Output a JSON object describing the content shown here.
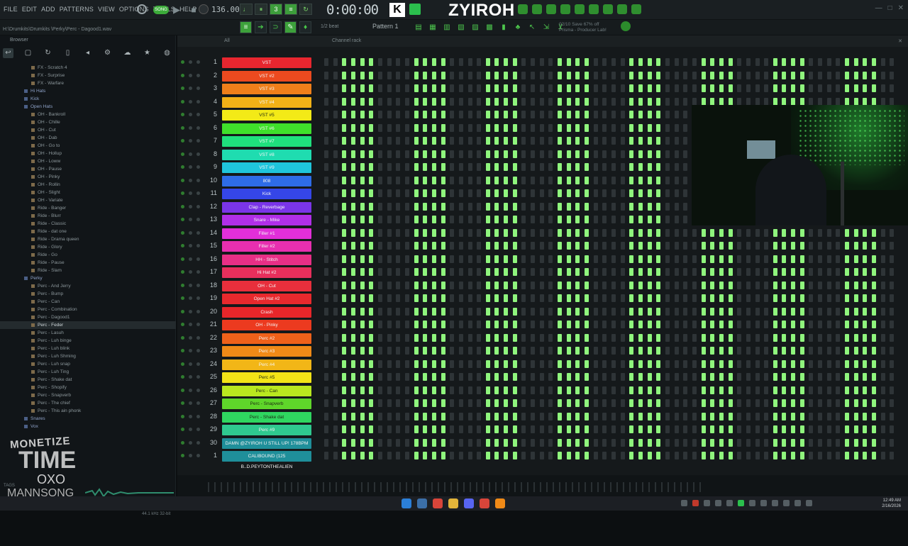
{
  "menu": [
    "FILE",
    "EDIT",
    "ADD",
    "PATTERNS",
    "VIEW",
    "OPTIONS",
    "TOOLS",
    "HELP"
  ],
  "tempo": "136.000",
  "song_button": "SONG",
  "time": "0:00:00",
  "streamer": "ZYIROH",
  "path": "H:\\Drumkits\\Drumkits \\Perky\\Perc - Dagood1.wav",
  "beat_snap": "1/2 beat",
  "pattern": "Pattern 1",
  "info_line1": "02/10  Save 67% off",
  "info_line2": "Prisma - Producer Lab!",
  "browser_title": "Browser",
  "channel_rack_title": "Channel rack",
  "channel_rack_filter": "All",
  "tree": [
    {
      "label": "FX - Scratch 4",
      "type": "file",
      "indent": 1
    },
    {
      "label": "FX - Surprise",
      "type": "file",
      "indent": 1
    },
    {
      "label": "FX - Warfare",
      "type": "file",
      "indent": 1
    },
    {
      "label": "Hi Hats",
      "type": "folder",
      "indent": 0
    },
    {
      "label": "Kick",
      "type": "folder",
      "indent": 0
    },
    {
      "label": "Open Hats",
      "type": "folder",
      "indent": 0
    },
    {
      "label": "OH - Bankroll",
      "type": "file",
      "indent": 1
    },
    {
      "label": "OH - Chille",
      "type": "file",
      "indent": 1
    },
    {
      "label": "OH - Cut",
      "type": "file",
      "indent": 1
    },
    {
      "label": "OH - Dab",
      "type": "file",
      "indent": 1
    },
    {
      "label": "OH - Go to",
      "type": "file",
      "indent": 1
    },
    {
      "label": "OH - Hollup",
      "type": "file",
      "indent": 1
    },
    {
      "label": "OH - Loww",
      "type": "file",
      "indent": 1
    },
    {
      "label": "OH - Pause",
      "type": "file",
      "indent": 1
    },
    {
      "label": "OH - Pinky",
      "type": "file",
      "indent": 1
    },
    {
      "label": "OH - Rollin",
      "type": "file",
      "indent": 1
    },
    {
      "label": "OH - Slight",
      "type": "file",
      "indent": 1
    },
    {
      "label": "OH - Variate",
      "type": "file",
      "indent": 1
    },
    {
      "label": "Ride - Banger",
      "type": "file",
      "indent": 1
    },
    {
      "label": "Ride - Blurr",
      "type": "file",
      "indent": 1
    },
    {
      "label": "Ride - Classic",
      "type": "file",
      "indent": 1
    },
    {
      "label": "Ride - dat one",
      "type": "file",
      "indent": 1
    },
    {
      "label": "Ride - Drama queen",
      "type": "file",
      "indent": 1
    },
    {
      "label": "Ride - Glory",
      "type": "file",
      "indent": 1
    },
    {
      "label": "Ride - Go",
      "type": "file",
      "indent": 1
    },
    {
      "label": "Ride - Pause",
      "type": "file",
      "indent": 1
    },
    {
      "label": "Ride - Slam",
      "type": "file",
      "indent": 1
    },
    {
      "label": "Perky",
      "type": "folder",
      "indent": 0
    },
    {
      "label": "Perc - And Jerry",
      "type": "file",
      "indent": 1
    },
    {
      "label": "Perc - Bump",
      "type": "file",
      "indent": 1
    },
    {
      "label": "Perc - Can",
      "type": "file",
      "indent": 1
    },
    {
      "label": "Perc - Combination",
      "type": "file",
      "indent": 1
    },
    {
      "label": "Perc - Dagood1",
      "type": "file",
      "indent": 1
    },
    {
      "label": "Perc - Feder",
      "type": "file",
      "indent": 1,
      "selected": true
    },
    {
      "label": "Perc - Lasuh",
      "type": "file",
      "indent": 1
    },
    {
      "label": "Perc - Luh binge",
      "type": "file",
      "indent": 1
    },
    {
      "label": "Perc - Luh blink",
      "type": "file",
      "indent": 1
    },
    {
      "label": "Perc - Luh Shming",
      "type": "file",
      "indent": 1
    },
    {
      "label": "Perc - Luh snap",
      "type": "file",
      "indent": 1
    },
    {
      "label": "Perc - Luh Ting",
      "type": "file",
      "indent": 1
    },
    {
      "label": "Perc - Shake dat",
      "type": "file",
      "indent": 1
    },
    {
      "label": "Perc - Shopify",
      "type": "file",
      "indent": 1
    },
    {
      "label": "Perc - Snapverb",
      "type": "file",
      "indent": 1
    },
    {
      "label": "Perc - The chief",
      "type": "file",
      "indent": 1
    },
    {
      "label": "Perc - This ain phonk",
      "type": "file",
      "indent": 1
    },
    {
      "label": "Snares",
      "type": "folder",
      "indent": 0
    },
    {
      "label": "Vox",
      "type": "folder",
      "indent": 0
    }
  ],
  "watermark": {
    "l1": "MONETIZE",
    "l2": "TIME",
    "l3": "OXO",
    "l4": "MANNSONG"
  },
  "sample_rate": "44.1 kHz 32-bit",
  "tags_label": "TAGS",
  "channels": [
    {
      "num": "1",
      "name": "VST",
      "color": "#e8262f"
    },
    {
      "num": "2",
      "name": "VST #2",
      "color": "#ec4a1f"
    },
    {
      "num": "3",
      "name": "VST #3",
      "color": "#ef7f1a"
    },
    {
      "num": "4",
      "name": "VST #4",
      "color": "#f2b117"
    },
    {
      "num": "5",
      "name": "VST #5",
      "color": "#f3ea17",
      "dark": true
    },
    {
      "num": "6",
      "name": "VST #6",
      "color": "#3fe02b"
    },
    {
      "num": "7",
      "name": "VST #7",
      "color": "#1fe07d"
    },
    {
      "num": "8",
      "name": "VST #8",
      "color": "#1fdcb0"
    },
    {
      "num": "9",
      "name": "VST #9",
      "color": "#1fc5dc"
    },
    {
      "num": "10",
      "name": "808",
      "color": "#2e6ce8"
    },
    {
      "num": "11",
      "name": "Kick",
      "color": "#3546e8"
    },
    {
      "num": "12",
      "name": "Clap - Reverbage",
      "color": "#7a35e8"
    },
    {
      "num": "13",
      "name": "Snare - Mike",
      "color": "#b12fe8"
    },
    {
      "num": "14",
      "name": "Filler #1",
      "color": "#e22fd9"
    },
    {
      "num": "15",
      "name": "Filler #2",
      "color": "#e82fb0"
    },
    {
      "num": "16",
      "name": "HH - Stitch",
      "color": "#e82f86"
    },
    {
      "num": "17",
      "name": "Hi Hat #2",
      "color": "#e82f5c"
    },
    {
      "num": "18",
      "name": "OH - Cut",
      "color": "#e82f3c"
    },
    {
      "num": "19",
      "name": "Open Hat #2",
      "color": "#e8292d"
    },
    {
      "num": "20",
      "name": "Crash",
      "color": "#e8262a"
    },
    {
      "num": "21",
      "name": "OH - Pinky",
      "color": "#ec3a1f"
    },
    {
      "num": "22",
      "name": "Perc #2",
      "color": "#ef611a"
    },
    {
      "num": "23",
      "name": "Perc #3",
      "color": "#f08a17"
    },
    {
      "num": "24",
      "name": "Perc #4",
      "color": "#f2b617"
    },
    {
      "num": "25",
      "name": "Perc #5",
      "color": "#f3e317",
      "dark": true
    },
    {
      "num": "26",
      "name": "Perc - Can",
      "color": "#b9e81f",
      "dark": true
    },
    {
      "num": "27",
      "name": "Perc - Snapverb",
      "color": "#5fd62a",
      "dark": true
    },
    {
      "num": "28",
      "name": "Perc - Shake dat",
      "color": "#2fd660",
      "dark": true
    },
    {
      "num": "29",
      "name": "Perc #9",
      "color": "#2fc98f"
    },
    {
      "num": "30",
      "name": "DAMN @ZYIROH U STILL UP! 178BPM",
      "color": "#1f8f9a"
    },
    {
      "num": "1",
      "name": "CALIBOUND (125 B..D.PEYTONTHEALIEN",
      "color": "#1f8f9a"
    }
  ],
  "taskbar": {
    "time": "12:49 AM",
    "date": "2/16/2026"
  }
}
